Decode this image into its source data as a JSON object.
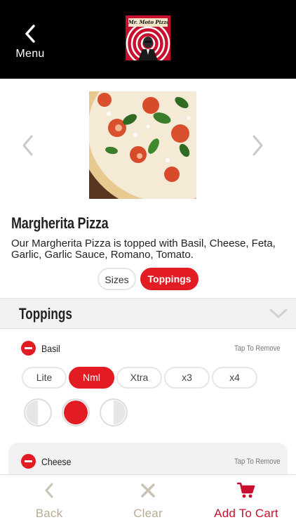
{
  "header": {
    "back_label": "Menu",
    "logo_text": "Mr. Moto Pizza"
  },
  "product": {
    "name": "Margherita Pizza",
    "description": "Our Margherita Pizza is topped with Basil, Cheese, Feta, Garlic, Garlic Sauce, Romano, Tomato."
  },
  "segments": {
    "sizes_label": "Sizes",
    "toppings_label": "Toppings",
    "selected": "Toppings"
  },
  "toppings_section": {
    "title": "Toppings",
    "items": [
      {
        "name": "Basil",
        "action": "Tap To Remove",
        "amounts": [
          "Lite",
          "Nml",
          "Xtra",
          "x3",
          "x4"
        ],
        "selected_amount": "Nml",
        "portion_options": [
          "left-half",
          "whole",
          "right-half"
        ],
        "selected_portion": "whole"
      },
      {
        "name": "Cheese",
        "action": "Tap To Remove"
      }
    ]
  },
  "bottom_bar": {
    "back_label": "Back",
    "clear_label": "Clear",
    "cart_label": "Add To Cart"
  },
  "colors": {
    "accent": "#e31b23",
    "header_bg": "#000000",
    "inactive_tab": "#b8ad94",
    "cart_tab": "#c8102e"
  }
}
